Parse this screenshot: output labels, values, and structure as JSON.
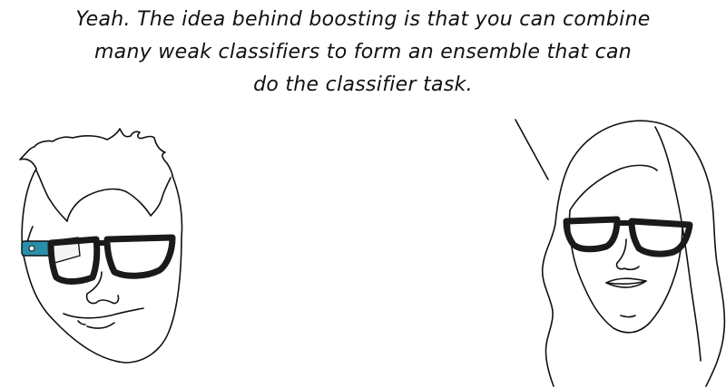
{
  "comic": {
    "speech_lines": [
      "Yeah. The idea behind boosting is that you can combine",
      "many weak classifiers to form an ensemble that can",
      "do the classifier task."
    ]
  },
  "colors": {
    "ink": "#111111",
    "background": "#ffffff",
    "glass_device": "#2a8fa8"
  }
}
